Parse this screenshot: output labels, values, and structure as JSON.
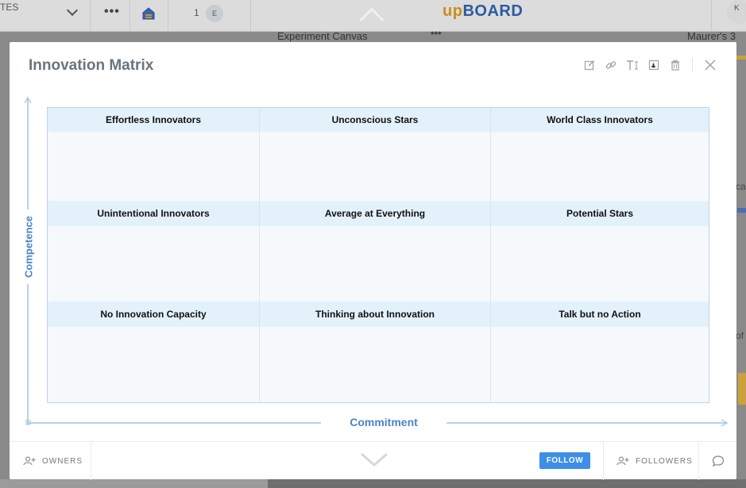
{
  "background": {
    "left_text": "TES",
    "member_count": "1",
    "member_initial": "E",
    "logo_up": "up",
    "logo_board": "BOARD",
    "user_initial": "K",
    "panels": [
      "Experiment Canvas",
      "Maurer's 3"
    ],
    "edge_texts": [
      "ca",
      "of"
    ]
  },
  "modal": {
    "title": "Innovation Matrix",
    "toolbar_icons": [
      "edit-icon",
      "link-icon",
      "text-icon",
      "pdf-icon",
      "trash-icon",
      "close-icon"
    ]
  },
  "matrix": {
    "y_axis_label": "Competence",
    "x_axis_label": "Commitment",
    "rows": [
      [
        "Effortless Innovators",
        "Unconscious Stars",
        "World Class Innovators"
      ],
      [
        "Unintentional Innovators",
        "Average at Everything",
        "Potential Stars"
      ],
      [
        "No Innovation Capacity",
        "Thinking about Innovation",
        "Talk but no Action"
      ]
    ]
  },
  "footer": {
    "owners_label": "OWNERS",
    "follow_label": "FOLLOW",
    "followers_label": "FOLLOWERS"
  },
  "colors": {
    "accent": "#3d8fe6",
    "axis_label": "#4a84c8",
    "header_fill": "#e3f1fb",
    "logo_up": "#c98e1a",
    "logo_board": "#2c5aa0"
  }
}
